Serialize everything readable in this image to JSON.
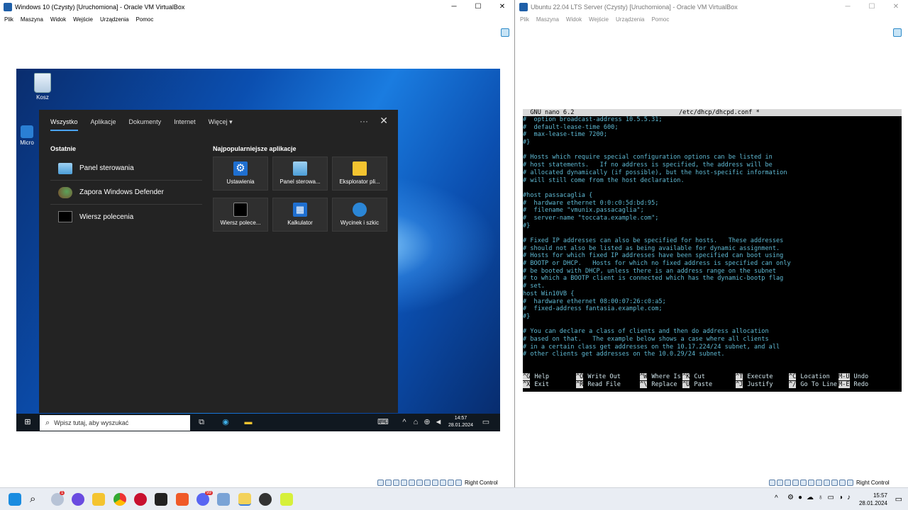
{
  "left_window": {
    "title": "Windows 10 (Czysty) [Uruchomiona] - Oracle VM VirtualBox",
    "menu": [
      "Plik",
      "Maszyna",
      "Widok",
      "Wejście",
      "Urządzenia",
      "Pomoc"
    ],
    "status_right": "Right Control"
  },
  "right_window": {
    "title": "Ubuntu 22.04 LTS Server (Czysty) [Uruchomiona] - Oracle VM VirtualBox",
    "menu": [
      "Plik",
      "Maszyna",
      "Widok",
      "Wejście",
      "Urządzenia",
      "Pomoc"
    ],
    "status_right": "Right Control"
  },
  "win10": {
    "desktop_icons": [
      "Kosz",
      "Micro"
    ],
    "flyout": {
      "tabs": [
        "Wszystko",
        "Aplikacje",
        "Dokumenty",
        "Internet",
        "Więcej"
      ],
      "recent_heading": "Ostatnie",
      "recent": [
        "Panel sterowania",
        "Zapora Windows Defender",
        "Wiersz polecenia"
      ],
      "top_heading": "Najpopularniejsze aplikacje",
      "top_apps": [
        "Ustawienia",
        "Panel sterowa...",
        "Eksplorator pli...",
        "Wiersz polece...",
        "Kalkulator",
        "Wycinek i szkic"
      ],
      "more_icon": "more-icon",
      "close_icon": "close-icon"
    },
    "taskbar": {
      "search_placeholder": "Wpisz tutaj, aby wyszukać",
      "time": "14:57",
      "date": "28.01.2024"
    }
  },
  "nano": {
    "header_left": "  GNU nano 6.2",
    "header_right": "/etc/dhcp/dhcpd.conf *",
    "lines": [
      "#  option broadcast-address 10.5.5.31;",
      "#  default-lease-time 600;",
      "#  max-lease-time 7200;",
      "#}",
      "",
      "# Hosts which require special configuration options can be listed in",
      "# host statements.   If no address is specified, the address will be",
      "# allocated dynamically (if possible), but the host-specific information",
      "# will still come from the host declaration.",
      "",
      "#host passacaglia {",
      "#  hardware ethernet 0:0:c0:5d:bd:95;",
      "#  filename \"vmunix.passacaglia\";",
      "#  server-name \"toccata.example.com\";",
      "#}",
      "",
      "# Fixed IP addresses can also be specified for hosts.   These addresses",
      "# should not also be listed as being available for dynamic assignment.",
      "# Hosts for which fixed IP addresses have been specified can boot using",
      "# BOOTP or DHCP.   Hosts for which no fixed address is specified can only",
      "# be booted with DHCP, unless there is an address range on the subnet",
      "# to which a BOOTP client is connected which has the dynamic-bootp flag",
      "# set.",
      "host Win10VB {",
      "#  hardware ethernet 08:00:07:26:c0:a5;",
      "#  fixed-address fantasia.example.com;",
      "#}",
      "",
      "# You can declare a class of clients and then do address allocation",
      "# based on that.   The example below shows a case where all clients",
      "# in a certain class get addresses on the 10.17.224/24 subnet, and all",
      "# other clients get addresses on the 10.0.29/24 subnet."
    ],
    "shortcuts": [
      {
        "k1": "^G",
        "l1": "Help",
        "k2": "^X",
        "l2": "Exit"
      },
      {
        "k1": "^O",
        "l1": "Write Out",
        "k2": "^R",
        "l2": "Read File"
      },
      {
        "k1": "^W",
        "l1": "Where Is",
        "k2": "^\\",
        "l2": "Replace"
      },
      {
        "k1": "^K",
        "l1": "Cut",
        "k2": "^U",
        "l2": "Paste"
      },
      {
        "k1": "^T",
        "l1": "Execute",
        "k2": "^J",
        "l2": "Justify"
      },
      {
        "k1": "^C",
        "l1": "Location",
        "k2": "^/",
        "l2": "Go To Line"
      },
      {
        "k1": "M-U",
        "l1": "Undo",
        "k2": "M-E",
        "l2": "Redo"
      }
    ]
  },
  "host_taskbar": {
    "time": "15:57",
    "date": "28.01.2024",
    "badge": "1",
    "discord_badge": "99"
  }
}
